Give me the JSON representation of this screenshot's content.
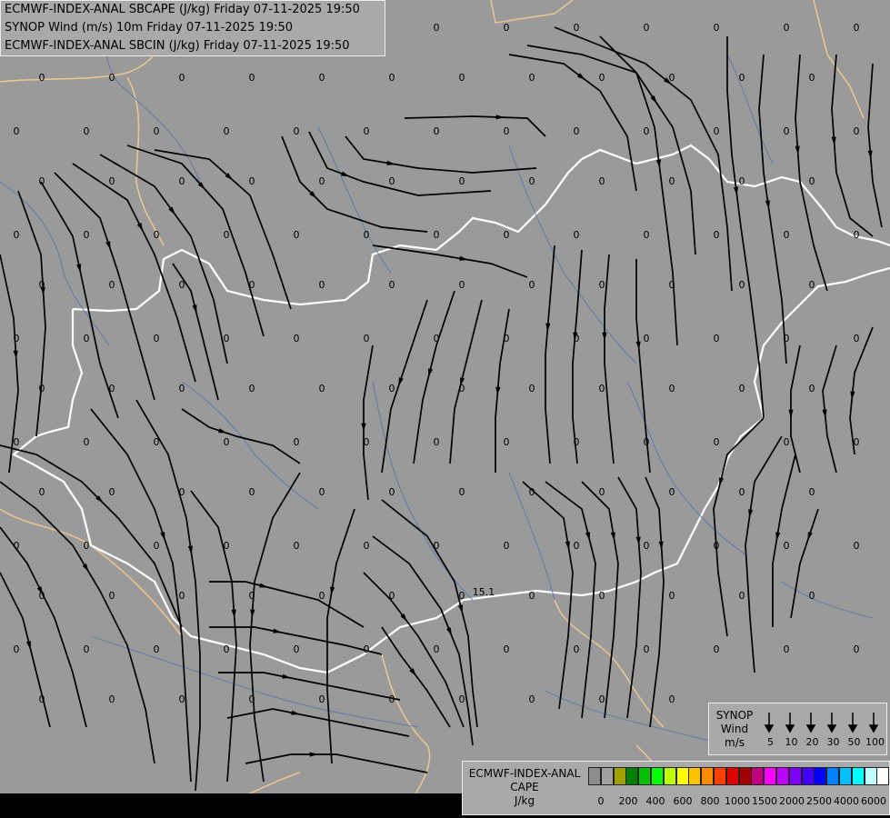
{
  "header": {
    "lines": [
      "ECMWF-INDEX-ANAL SBCAPE (J/kg) Friday 07-11-2025 19:50",
      "SYNOP Wind (m/s) 10m Friday 07-11-2025 19:50",
      "ECMWF-INDEX-ANAL SBCIN (J/kg) Friday 07-11-2025 19:50"
    ]
  },
  "map": {
    "values": [
      "0",
      "0",
      "0",
      "0",
      "0",
      "0",
      "0",
      "0",
      "0",
      "0",
      "0",
      "0",
      "0",
      "0",
      "0",
      "0",
      "0",
      "0",
      "0",
      "0",
      "0",
      "0",
      "0",
      "0",
      "0",
      "0",
      "0",
      "0",
      "0",
      "0",
      "0",
      "0",
      "0",
      "0",
      "0",
      "0",
      "0",
      "0",
      "0",
      "0",
      "0",
      "0",
      "0",
      "0",
      "0",
      "0",
      "0",
      "0",
      "0",
      "0",
      "0",
      "0",
      "0",
      "0",
      "0",
      "0",
      "0",
      "0",
      "0",
      "0",
      "0",
      "0",
      "0",
      "0",
      "0",
      "0",
      "0",
      "0",
      "0",
      "0",
      "0",
      "0",
      "0",
      "0",
      "0",
      "0",
      "0",
      "0",
      "0",
      "0",
      "0",
      "0",
      "0",
      "0",
      "0",
      "0",
      "0",
      "0",
      "0",
      "0",
      "0",
      "0",
      "0",
      "0",
      "0",
      "0",
      "0",
      "0",
      "0",
      "0",
      "0",
      "0",
      "0",
      "0",
      "0",
      "0",
      "0",
      "0",
      "0",
      "0",
      "0",
      "0",
      "0",
      "0",
      "0",
      "0",
      "0",
      "0",
      "0",
      "0",
      "0",
      "0",
      "0",
      "0",
      "0",
      "0",
      "0",
      "0",
      "0",
      "0",
      "0",
      "0",
      "0",
      "0",
      "0",
      "0",
      "0",
      "0",
      "0",
      "0",
      "0",
      "0",
      "0",
      "0",
      "0",
      "0",
      "0",
      "0",
      "0",
      "0",
      "0",
      "0",
      "0",
      "0",
      "0",
      "0",
      "0",
      "0",
      "0",
      "0",
      "0",
      "0",
      "0",
      "0",
      "0",
      "0",
      "0",
      "0",
      "0",
      "0"
    ],
    "extra_value": "15.1"
  },
  "legend_wind": {
    "title": "SYNOP\nWind\nm/s",
    "speeds": [
      "5",
      "10",
      "20",
      "30",
      "50",
      "100"
    ]
  },
  "legend_cape": {
    "title": "ECMWF-INDEX-ANAL\nCAPE\nJ/kg",
    "colors": [
      "#8c8c8c",
      "#a0a0a0",
      "#a0a000",
      "#008000",
      "#00c000",
      "#00ff00",
      "#c0ff00",
      "#ffff00",
      "#ffc000",
      "#ff8c00",
      "#ff4000",
      "#e00000",
      "#a00000",
      "#c00080",
      "#ff00ff",
      "#c000ff",
      "#8000ff",
      "#4000ff",
      "#0000ff",
      "#0080ff",
      "#00c0ff",
      "#00ffff",
      "#c0ffff",
      "#ffffff"
    ],
    "ticks": [
      "0",
      "200",
      "400",
      "600",
      "800",
      "1000",
      "1500",
      "2000",
      "2500",
      "4000",
      "6000"
    ]
  }
}
